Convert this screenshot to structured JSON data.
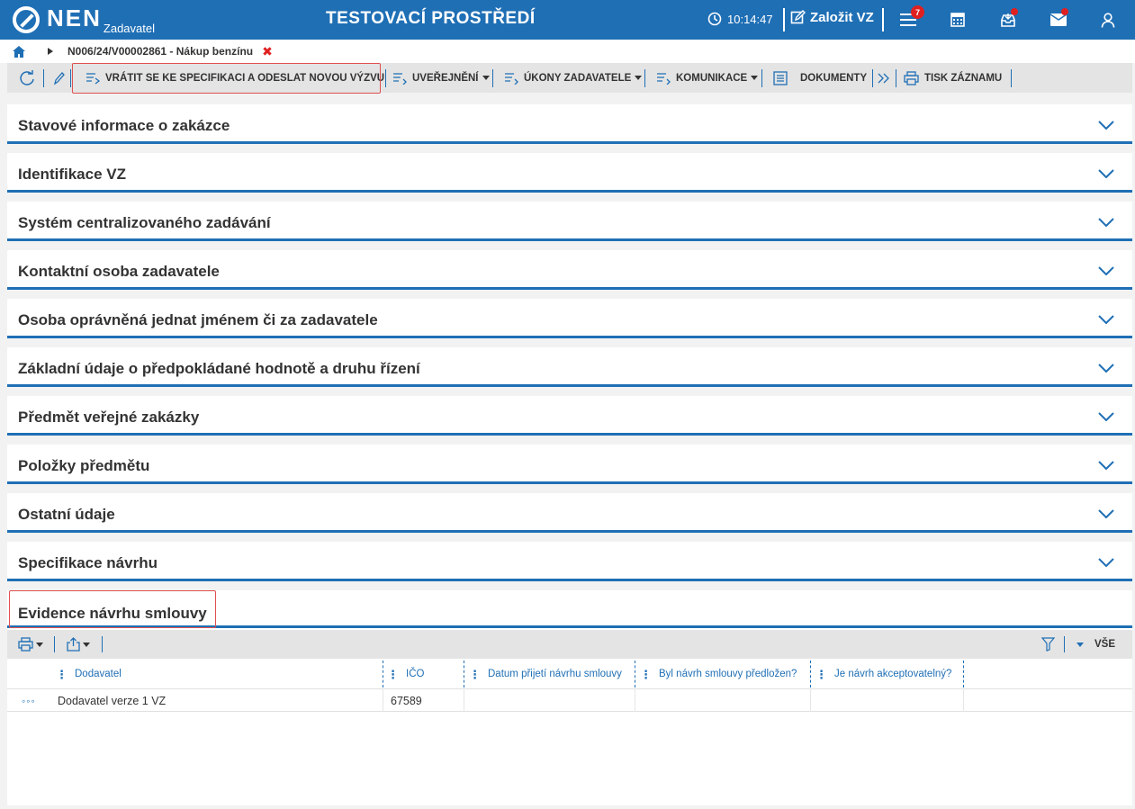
{
  "topbar": {
    "logo_text": "NEN",
    "logo_sub": "Zadavatel",
    "env_title": "TESTOVACÍ PROSTŘEDÍ",
    "time": "10:14:47",
    "create_label": "Založit VZ",
    "menu_badge": "7",
    "icons": [
      "clock-icon",
      "edit-icon",
      "menu-icon",
      "calculator-icon",
      "inbox-icon",
      "mail-icon",
      "user-icon"
    ],
    "accent_color": "#1f6fb5"
  },
  "breadcrumb": {
    "record": "N006/24/V00002861 - Nákup benzínu",
    "close_symbol": "✖"
  },
  "toolbar": {
    "return_label": "VRÁTIT SE KE SPECIFIKACI A ODESLAT NOVOU VÝZVU",
    "publish_label": "UVEŘEJNĚNÍ",
    "actions_label": "ÚKONY ZADAVATELE",
    "communication_label": "KOMUNIKACE",
    "documents_label": "DOKUMENTY",
    "print_label": "TISK ZÁZNAMU"
  },
  "sections": [
    "Stavové informace o zakázce",
    "Identifikace VZ",
    "Systém centralizovaného zadávání",
    "Kontaktní osoba zadavatele",
    "Osoba oprávněná jednat jménem či za zadavatele",
    "Základní údaje o předpokládané hodnotě a druhu řízení",
    "Předmět veřejné zakázky",
    "Položky předmětu",
    "Ostatní údaje",
    "Specifikace návrhu"
  ],
  "evidence": {
    "title": "Evidence návrhu smlouvy",
    "filter_label": "VŠE",
    "columns": [
      "Dodavatel",
      "IČO",
      "Datum přijetí návrhu smlouvy",
      "Byl návrh smlouvy předložen?",
      "Je návrh akceptovatelný?"
    ],
    "rows": [
      {
        "menu": "◦◦◦",
        "dodavatel": "Dodavatel verze 1 VZ",
        "ico": "67589",
        "datum": "",
        "predlozen": "",
        "akceptovatelny": ""
      }
    ]
  }
}
